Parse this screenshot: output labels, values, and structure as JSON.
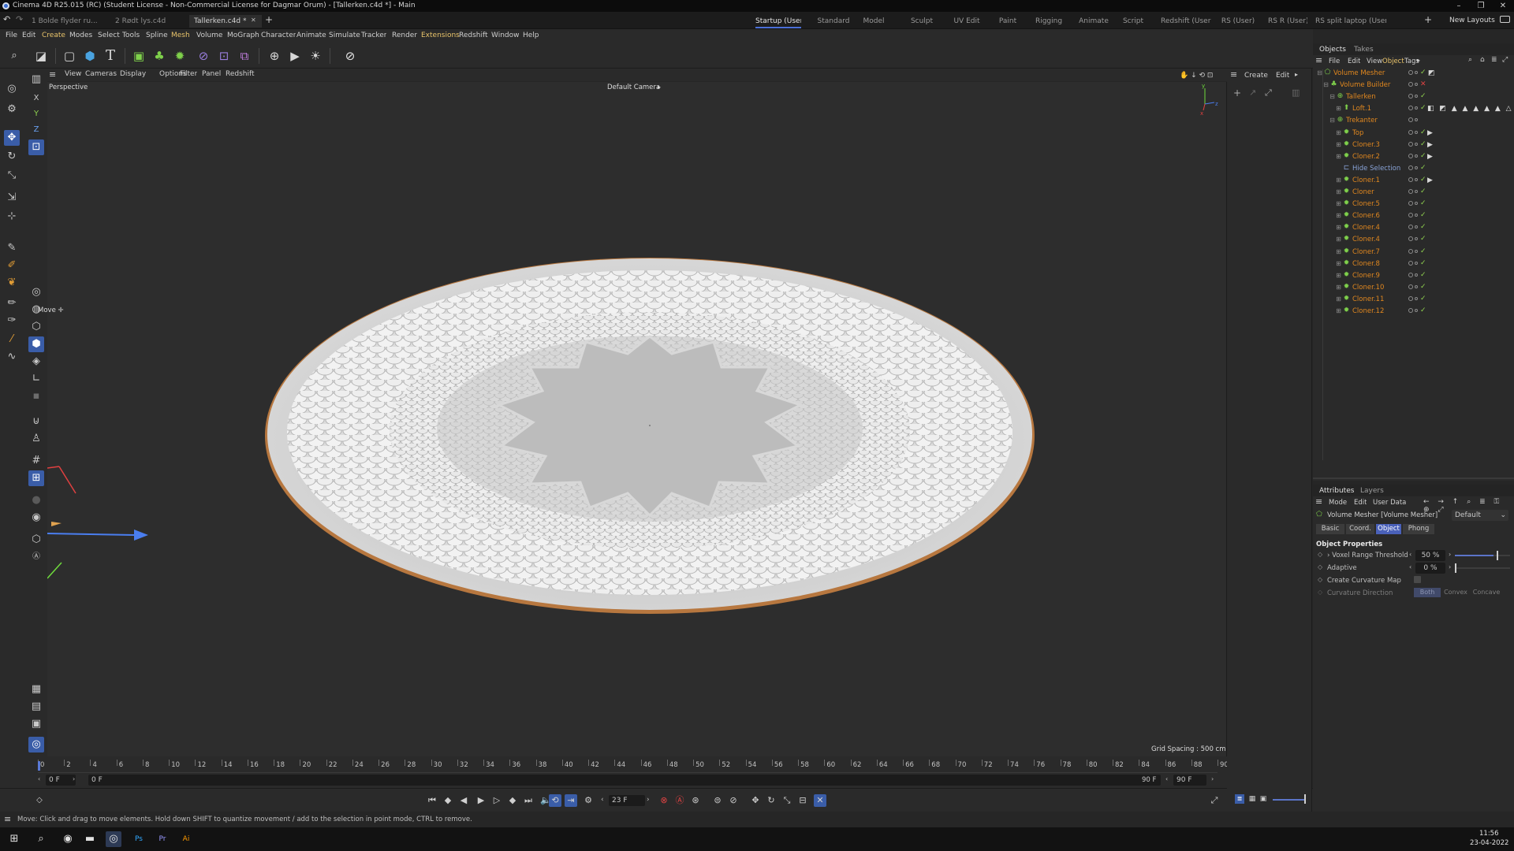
{
  "window": {
    "title": "Cinema 4D R25.015 (RC) (Student License - Non-Commercial License for Dagmar Orum) - [Tallerken.c4d *] - Main"
  },
  "doc_tabs": [
    {
      "label": "1 Bolde flyder ru...",
      "active": false
    },
    {
      "label": "2 Rødt lys.c4d",
      "active": false
    },
    {
      "label": "Tallerken.c4d *",
      "active": true
    }
  ],
  "layout_tabs": [
    "Startup (User)",
    "Standard",
    "Model",
    "Sculpt",
    "UV Edit",
    "Paint",
    "Rigging",
    "Animate",
    "Script",
    "Redshift (User)",
    "RS (User)",
    "RS R (User)",
    "RS split laptop (User)"
  ],
  "new_layouts_label": "New Layouts",
  "menus": [
    "File",
    "Edit",
    "Create",
    "Modes",
    "Select",
    "Tools",
    "Spline",
    "Mesh",
    "Volume",
    "MoGraph",
    "Character",
    "Animate",
    "Simulate",
    "Tracker",
    "Render",
    "Extensions",
    "Redshift",
    "Window",
    "Help"
  ],
  "viewport": {
    "menus": [
      "View",
      "Cameras",
      "Display",
      "Options",
      "Filter",
      "Panel",
      "Redshift"
    ],
    "view_name": "Perspective",
    "camera": "Default Camera",
    "move_label": "Move",
    "grid_spacing": "Grid Spacing : 500 cm"
  },
  "timeline": {
    "ticks": [
      0,
      2,
      4,
      6,
      8,
      10,
      12,
      14,
      16,
      18,
      20,
      22,
      24,
      26,
      28,
      30,
      32,
      34,
      36,
      38,
      40,
      42,
      44,
      46,
      48,
      50,
      52,
      54,
      56,
      58,
      60,
      62,
      64,
      66,
      68,
      70,
      72,
      74,
      76,
      78,
      80,
      82,
      84,
      86,
      88,
      90
    ],
    "start_field": "0 F",
    "start_field2": "0 F",
    "end_field": "90 F",
    "end_field2": "90 F",
    "current_frame": "23 F"
  },
  "coord_panel": {
    "menus": [
      "Create",
      "Edit"
    ]
  },
  "objects_panel": {
    "tabs": [
      "Objects",
      "Takes"
    ],
    "menus": [
      "File",
      "Edit",
      "View",
      "Object",
      "Tags"
    ],
    "items": [
      {
        "name": "Volume Mesher",
        "depth": 0,
        "color": "orange",
        "icon": "volume-mesher-icon",
        "status": "check"
      },
      {
        "name": "Volume Builder",
        "depth": 1,
        "color": "orange",
        "icon": "volume-builder-icon",
        "status": "x"
      },
      {
        "name": "Tallerken",
        "depth": 2,
        "color": "orange",
        "icon": "null-icon",
        "status": "check"
      },
      {
        "name": "Loft.1",
        "depth": 3,
        "color": "orange",
        "icon": "loft-icon",
        "status": "check"
      },
      {
        "name": "Trekanter",
        "depth": 2,
        "color": "orange",
        "icon": "null-icon",
        "status": "none"
      },
      {
        "name": "Top",
        "depth": 3,
        "color": "orange",
        "icon": "cloner-icon",
        "status": "check"
      },
      {
        "name": "Cloner.3",
        "depth": 3,
        "color": "orange",
        "icon": "cloner-icon",
        "status": "check"
      },
      {
        "name": "Cloner.2",
        "depth": 3,
        "color": "orange",
        "icon": "cloner-icon",
        "status": "check"
      },
      {
        "name": "Hide Selection",
        "depth": 3,
        "color": "blue",
        "icon": "selection-icon",
        "status": "check"
      },
      {
        "name": "Cloner.1",
        "depth": 3,
        "color": "orange",
        "icon": "cloner-icon",
        "status": "check"
      },
      {
        "name": "Cloner",
        "depth": 3,
        "color": "orange",
        "icon": "cloner-icon",
        "status": "check"
      },
      {
        "name": "Cloner.5",
        "depth": 3,
        "color": "orange",
        "icon": "cloner-icon",
        "status": "check"
      },
      {
        "name": "Cloner.6",
        "depth": 3,
        "color": "orange",
        "icon": "cloner-icon",
        "status": "check"
      },
      {
        "name": "Cloner.4",
        "depth": 3,
        "color": "orange",
        "icon": "cloner-icon",
        "status": "check"
      },
      {
        "name": "Cloner.4",
        "depth": 3,
        "color": "orange",
        "icon": "cloner-icon",
        "status": "check"
      },
      {
        "name": "Cloner.7",
        "depth": 3,
        "color": "orange",
        "icon": "cloner-icon",
        "status": "check"
      },
      {
        "name": "Cloner.8",
        "depth": 3,
        "color": "orange",
        "icon": "cloner-icon",
        "status": "check"
      },
      {
        "name": "Cloner.9",
        "depth": 3,
        "color": "orange",
        "icon": "cloner-icon",
        "status": "check"
      },
      {
        "name": "Cloner.10",
        "depth": 3,
        "color": "orange",
        "icon": "cloner-icon",
        "status": "check"
      },
      {
        "name": "Cloner.11",
        "depth": 3,
        "color": "orange",
        "icon": "cloner-icon",
        "status": "check"
      },
      {
        "name": "Cloner.12",
        "depth": 3,
        "color": "orange",
        "icon": "cloner-icon",
        "status": "check"
      }
    ]
  },
  "attributes_panel": {
    "tabs": [
      "Attributes",
      "Layers"
    ],
    "menus": [
      "Mode",
      "Edit",
      "User Data"
    ],
    "object_title": "Volume Mesher [Volume Mesher]",
    "preset": "Default",
    "subtabs": [
      "Basic",
      "Coord.",
      "Object",
      "Phong"
    ],
    "active_subtab": "Object",
    "section": "Object Properties",
    "voxel_label": "Voxel Range Threshold",
    "voxel_value": "50 %",
    "voxel_fraction": 0.5,
    "adaptive_label": "Adaptive",
    "adaptive_value": "0 %",
    "adaptive_fraction": 0.0,
    "curvature_label": "Create Curvature Map",
    "curv_dir_label": "Curvature Direction",
    "curv_dir_options": [
      "Both",
      "Convex",
      "Concave"
    ]
  },
  "status_text": "Move: Click and drag to move elements. Hold down SHIFT to quantize movement / add to the selection in point mode, CTRL to remove.",
  "taskbar": {
    "time": "11:56",
    "date": "23-04-2022",
    "apps": [
      {
        "name": "windows-start-icon",
        "glyph": "⊞"
      },
      {
        "name": "search-icon",
        "glyph": "⌕"
      },
      {
        "name": "chrome-icon",
        "glyph": "◉"
      },
      {
        "name": "file-explorer-icon",
        "glyph": "▬"
      },
      {
        "name": "cinema4d-icon",
        "glyph": "◎"
      },
      {
        "name": "photoshop-icon",
        "glyph": "Ps"
      },
      {
        "name": "premiere-icon",
        "glyph": "Pr"
      },
      {
        "name": "illustrator-icon",
        "glyph": "Ai"
      }
    ]
  },
  "colors": {
    "accent": "#4a61b9",
    "orange_text": "#e0871f",
    "check_green": "#8fd14f",
    "x_red": "#e04343"
  }
}
